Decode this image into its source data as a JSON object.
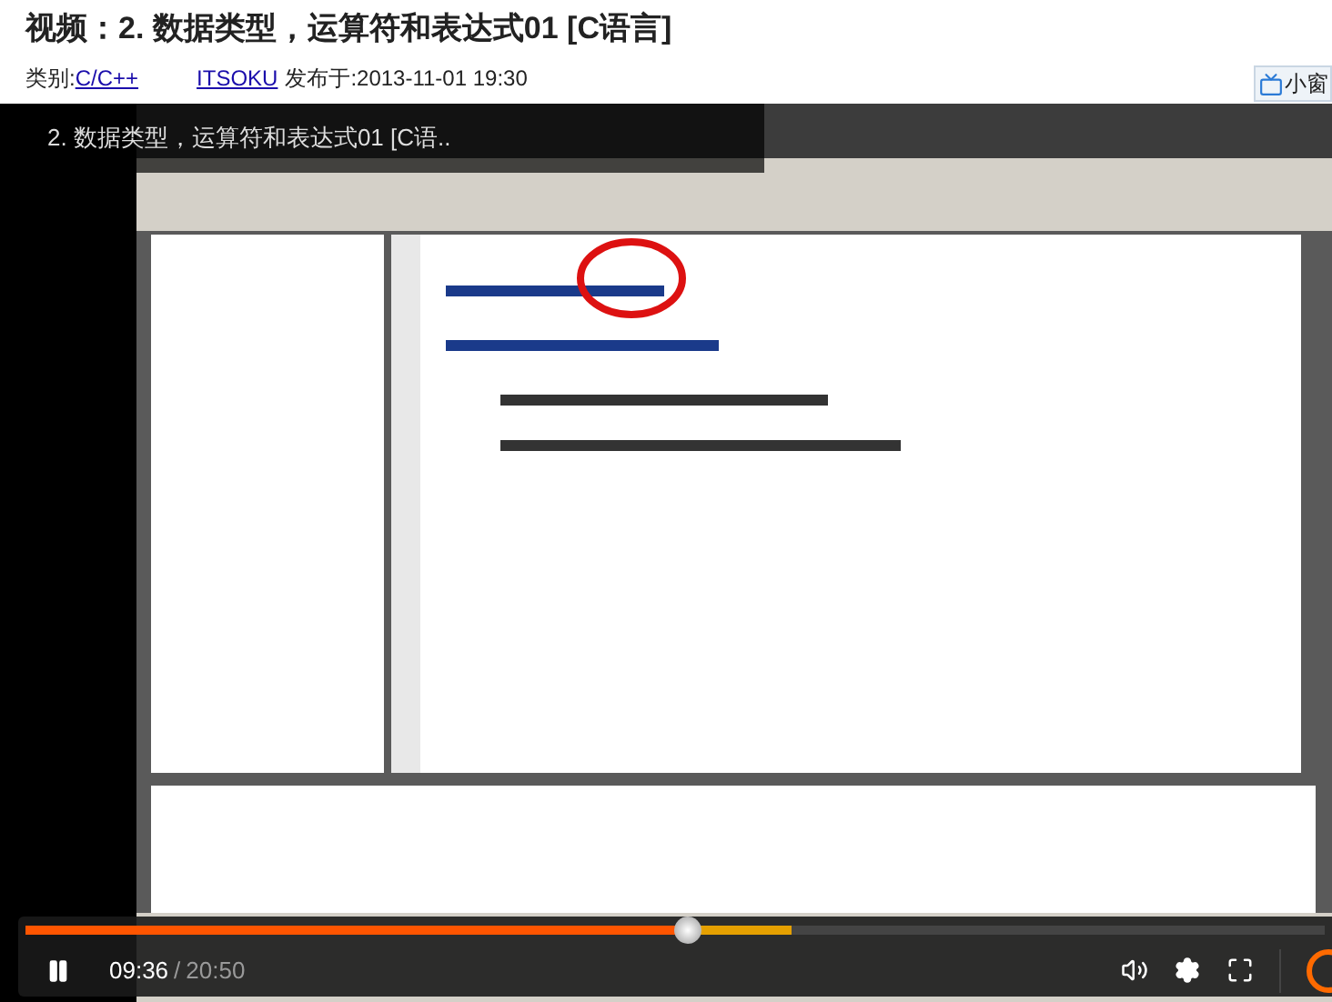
{
  "page_title": "视频：2. 数据类型，运算符和表达式01 [C语言]",
  "meta": {
    "category_label": "类别:",
    "category": "C/C++",
    "author": "ITSOKU",
    "published": "发布于:2013-11-01 19:30"
  },
  "mini_window_button": "小窗",
  "player": {
    "overlay_title": "2. 数据类型，运算符和表达式01 [C语..",
    "playing": true,
    "progress": {
      "level": 0.51,
      "buffered": {
        "level": 0.59
      }
    },
    "current_time": "09:36",
    "separator": "/",
    "duration": "20:50"
  }
}
